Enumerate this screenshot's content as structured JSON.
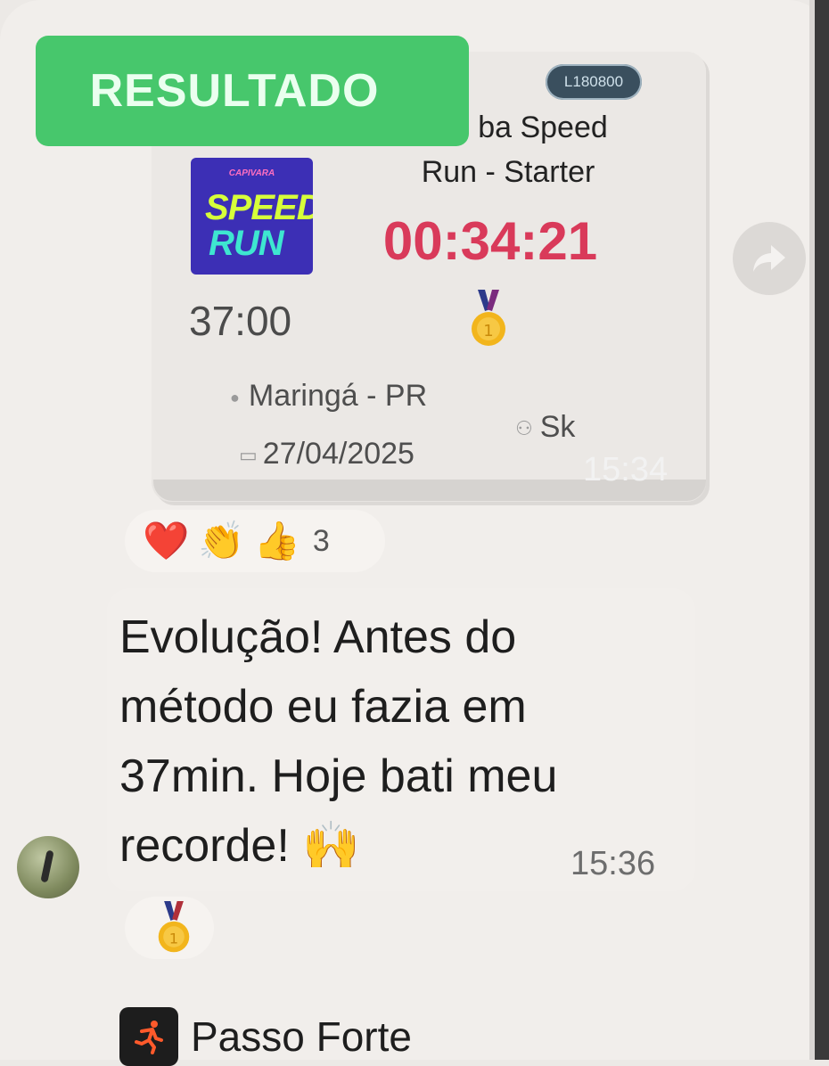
{
  "banner": {
    "label": "RESULTADO"
  },
  "event_card": {
    "bib_pill": "L180800",
    "event_name_line1": "ba Speed",
    "event_name_line2": "Run - Starter",
    "logo": {
      "brand_text": "CAPIVARA",
      "word1": "SPEED",
      "word2": "RUN"
    },
    "finish_time": "00:34:21",
    "previous_time": "37:00",
    "location": "Maringá - PR",
    "date": "27/04/2025",
    "person": "Sk",
    "timestamp": "15:34",
    "finish_time_color": "#d93a5a"
  },
  "reactions": {
    "emojis": [
      "❤️",
      "👏",
      "👍"
    ],
    "count": "3"
  },
  "message": {
    "text": "Evolução! Antes do método eu fazia em 37min. Hoje bati meu recorde! 🙌",
    "timestamp": "15:36"
  },
  "message_reaction": {
    "emoji": "🥇"
  },
  "next_sender": {
    "name": "Passo Forte"
  },
  "colors": {
    "banner": "#47c76c",
    "background": "#f1eeeb"
  }
}
